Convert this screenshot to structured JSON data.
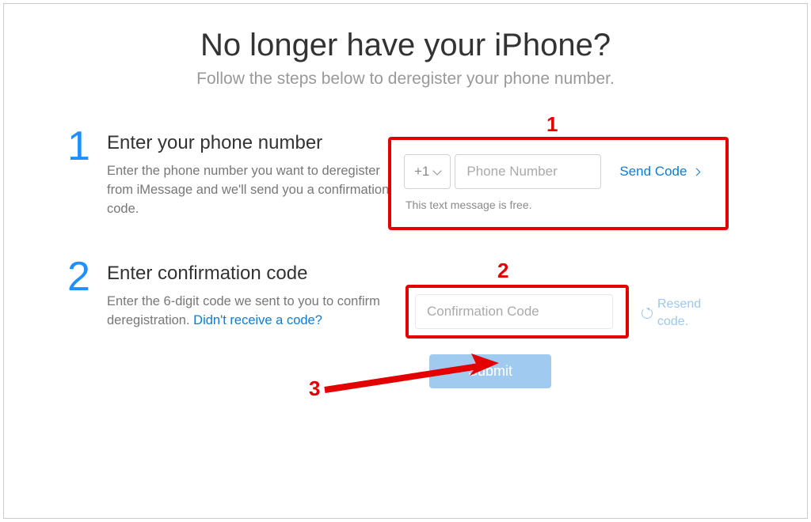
{
  "page_title": "No longer have your iPhone?",
  "page_subtitle": "Follow the steps below to deregister your phone number.",
  "step1": {
    "num": "1",
    "title": "Enter your phone number",
    "desc": "Enter the phone number you want to deregister from iMessage and we'll send you a confirmation code.",
    "country_code": "+1",
    "phone_placeholder": "Phone Number",
    "send_link": "Send Code",
    "hint": "This text message is free."
  },
  "step2": {
    "num": "2",
    "title": "Enter confirmation code",
    "desc_pre": "Enter the 6-digit code we sent to you to confirm deregistration. ",
    "desc_link": "Didn't receive a code?",
    "conf_placeholder": "Confirmation Code",
    "resend": "Resend code."
  },
  "submit_label": "Submit",
  "annotations": {
    "n1": "1",
    "n2": "2",
    "n3": "3"
  }
}
